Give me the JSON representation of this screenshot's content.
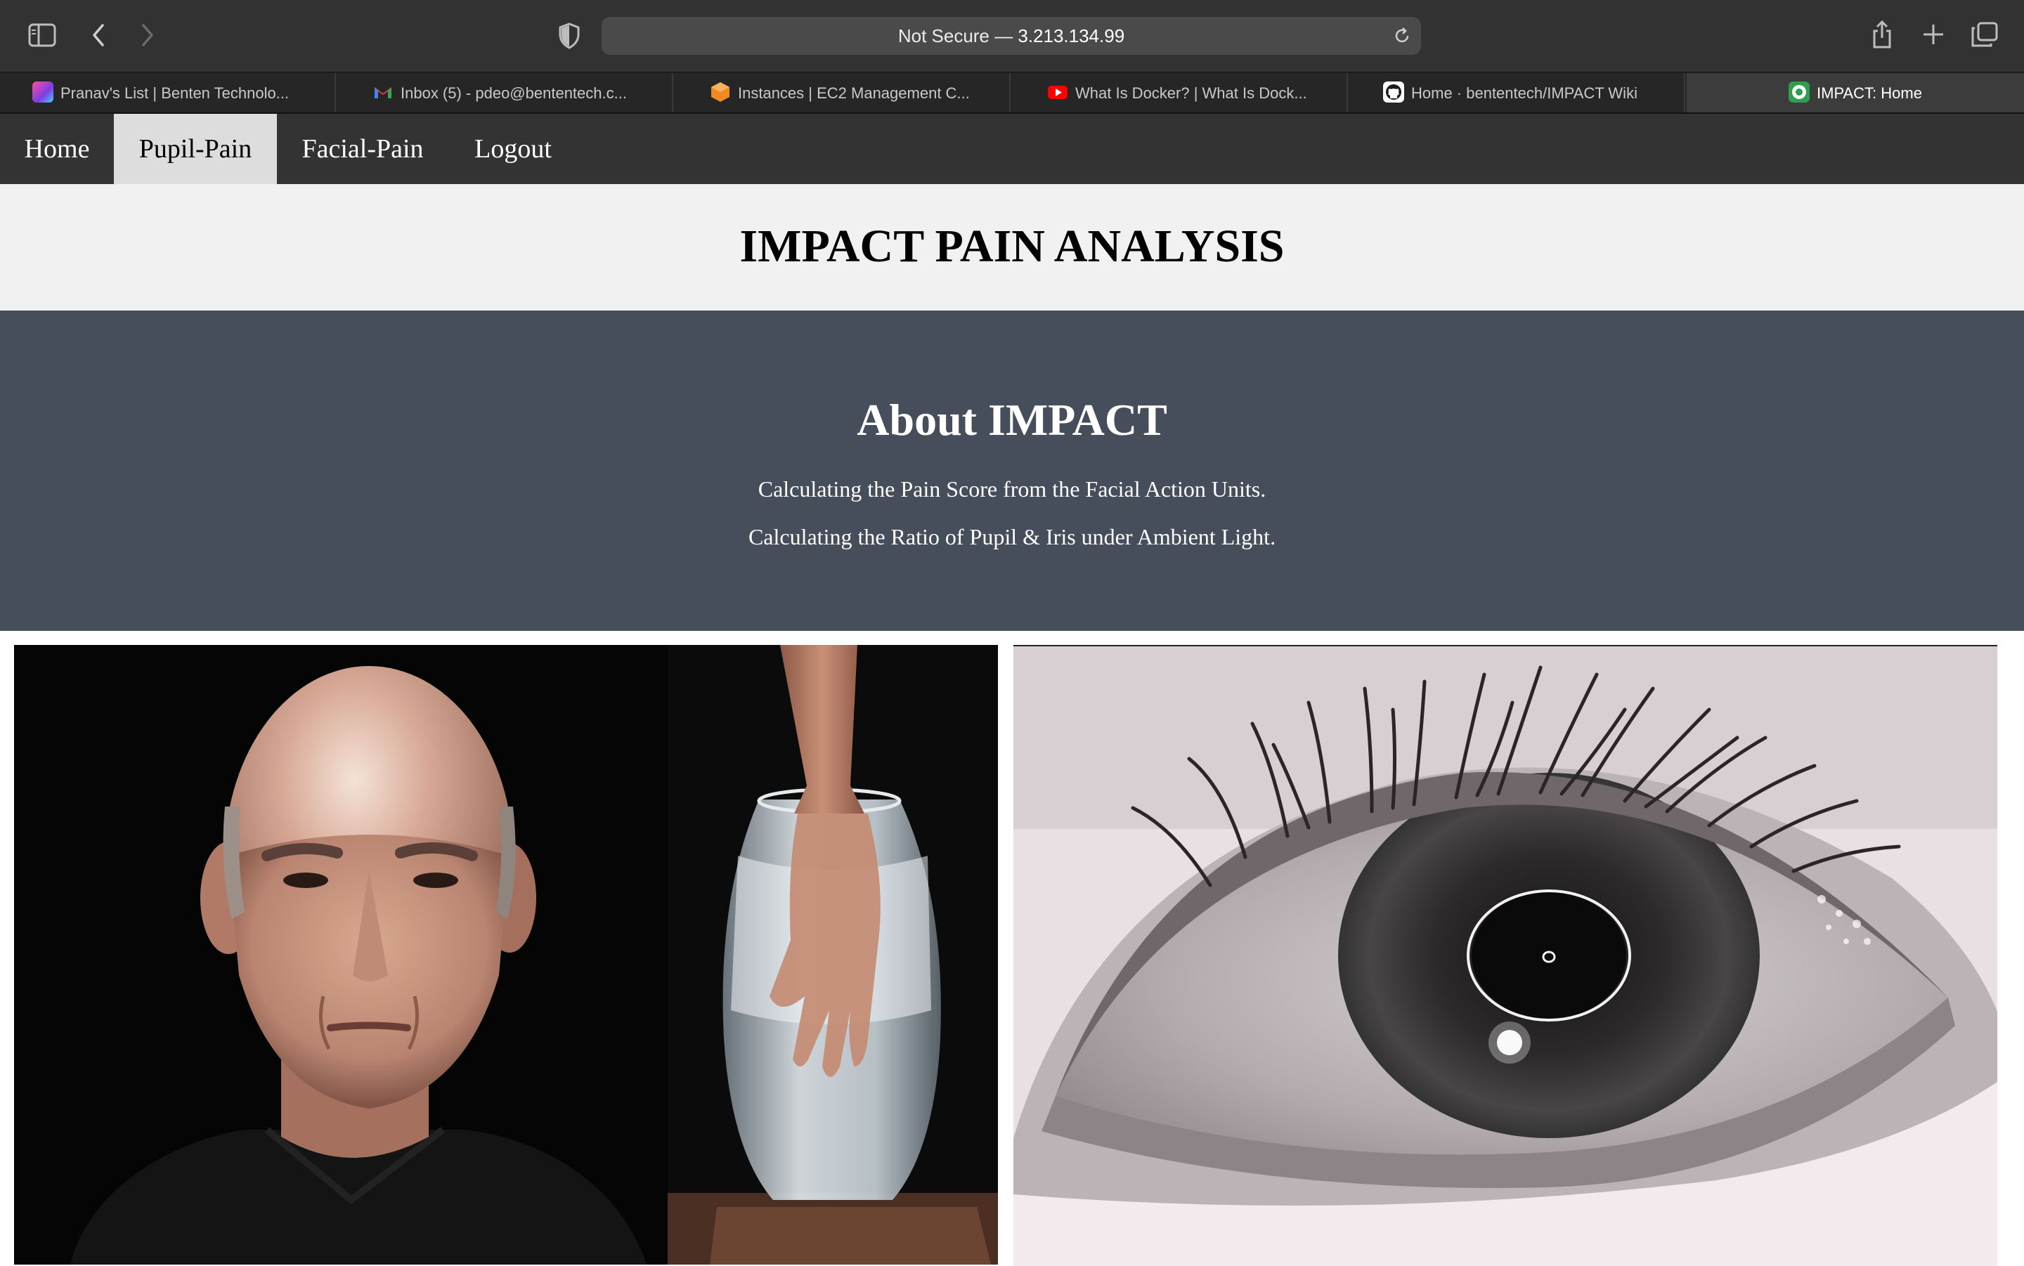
{
  "browser": {
    "url_prefix": "Not Secure — ",
    "url_host": "3.213.134.99",
    "icons": {
      "sidebar": "sidebar-toggle-icon",
      "back": "chevron-left-icon",
      "forward": "chevron-right-icon",
      "privacy": "shield-icon",
      "reload": "reload-icon",
      "share": "share-icon",
      "new_tab": "plus-icon",
      "tab_overview": "tab-overview-icon"
    }
  },
  "tabs": [
    {
      "title": "Pranav's List | Benten Technolo...",
      "favicon_color": "#7b3fe4"
    },
    {
      "title": "Inbox (5) - pdeo@bententech.c...",
      "favicon_color": "#ea4335"
    },
    {
      "title": "Instances | EC2 Management C...",
      "favicon_color": "#f08a24"
    },
    {
      "title": "What Is Docker? | What Is Dock...",
      "favicon_color": "#ff0000"
    },
    {
      "title": "Home · bententech/IMPACT Wiki",
      "favicon_color": "#ffffff"
    },
    {
      "title": "IMPACT: Home",
      "favicon_color": "#2e9e4f",
      "active": true
    }
  ],
  "nav": [
    {
      "label": "Home"
    },
    {
      "label": "Pupil-Pain",
      "active": true
    },
    {
      "label": "Facial-Pain"
    },
    {
      "label": "Logout"
    }
  ],
  "header": {
    "title": "IMPACT PAIN ANALYSIS"
  },
  "about": {
    "title": "About IMPACT",
    "lines": [
      "Calculating the Pain Score from the Facial Action Units.",
      "Calculating the Ratio of Pupil & Iris under Ambient Light."
    ]
  },
  "images": {
    "face": "man's face with hand in a vase of ice water",
    "eye": "grayscale close-up of an eye with pupil detection circle"
  },
  "colors": {
    "toolbar": "#323232",
    "nav_bg": "#333333",
    "nav_active": "#dddddd",
    "header_bg": "#f1f1f1",
    "about_bg": "#464e5c"
  }
}
